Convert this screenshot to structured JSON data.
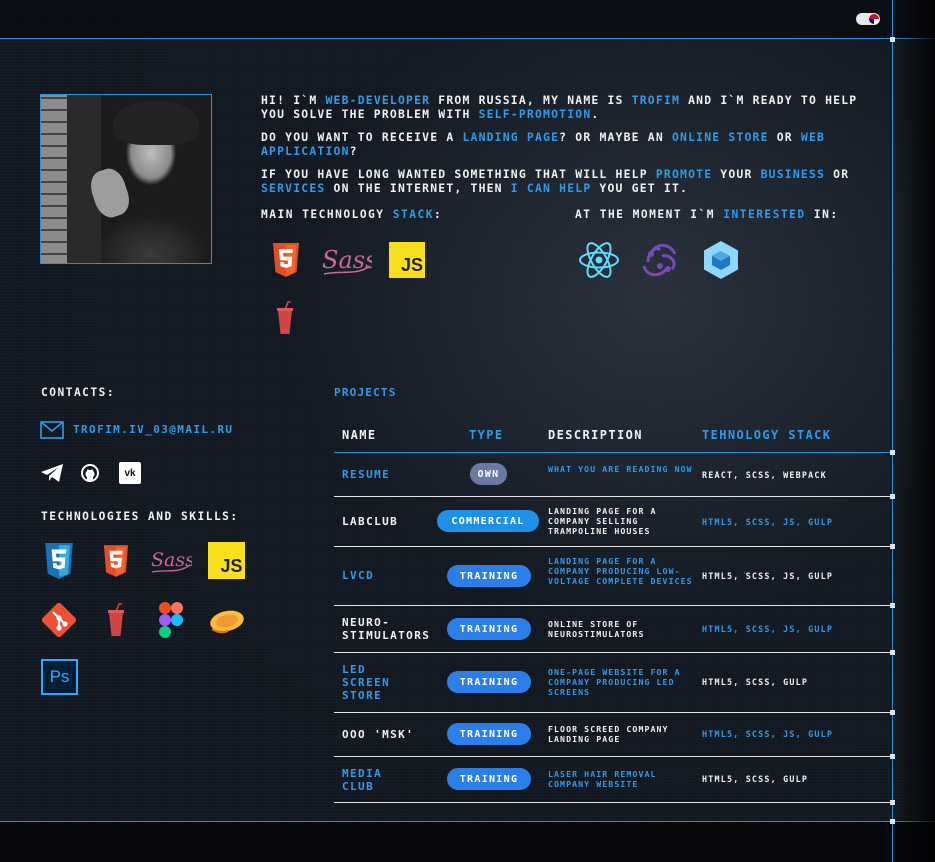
{
  "lang_toggle": {
    "flag_icon": "uk-flag-icon"
  },
  "intro": {
    "p1": [
      "Hi! I`m ",
      "web-developer",
      " from Russia, my name is ",
      "Trofim",
      " and I`m ready to help you solve the problem with ",
      "self-promotion",
      "."
    ],
    "p2": [
      "Do you want to receive a ",
      "landing page",
      "? Or maybe an ",
      "online store",
      " or ",
      "web application",
      "?"
    ],
    "p3": [
      "If you have long wanted something that will help ",
      "promote",
      " your ",
      "business",
      " or ",
      "services",
      " on the Internet, then ",
      "I can help",
      " you get it."
    ]
  },
  "stack": {
    "label_a": "Main technology ",
    "label_b": "stack",
    "label_c": ":",
    "icons": [
      "html5-icon",
      "sass-icon",
      "javascript-icon",
      "gulp-icon"
    ]
  },
  "interested": {
    "label_a": "At the moment I`m ",
    "label_b": "interested",
    "label_c": " in:",
    "icons": [
      "react-icon",
      "redux-icon",
      "webpack-icon"
    ]
  },
  "contacts": {
    "label": "Contacts:",
    "email": "trofim.iv_03@mail.ru",
    "social": [
      "telegram-icon",
      "github-icon",
      "vk-icon"
    ]
  },
  "skills": {
    "label": "Technologies and skills:",
    "icons": [
      "css3-icon",
      "html5-icon",
      "sass-icon",
      "javascript-icon",
      "git-icon",
      "gulp-icon",
      "figma-icon",
      "zeplin-icon",
      "photoshop-icon"
    ]
  },
  "projects": {
    "title": "Projects",
    "headers": {
      "name": "Name",
      "type": "Type",
      "description": "Description",
      "stack": "Tehnology stack"
    },
    "rows": [
      {
        "name": "Resume",
        "type": "own",
        "description": "What you are reading now",
        "stack": "React, SCSS, Webpack"
      },
      {
        "name": "LabClub",
        "type": "commercial",
        "description": "Landing page for a company selling trampoline houses",
        "stack": "HTML5, SCSS, JS, Gulp"
      },
      {
        "name": "LVCD",
        "type": "training",
        "description": "Landing page for a company producing low-voltage complete devices",
        "stack": "HTML5, SCSS, JS, Gulp"
      },
      {
        "name": "Neuro-stimulators",
        "type": "training",
        "description": "Online store of neurostimulators",
        "stack": "HTML5, SCSS, JS, Gulp"
      },
      {
        "name": "LED Screen Store",
        "type": "training",
        "description": "One-page website for a company producing LED screens",
        "stack": "HTML5, SCSS, Gulp"
      },
      {
        "name": "OOO 'MSK'",
        "type": "training",
        "description": "Floor screed company landing page",
        "stack": "HTML5, SCSS, JS, Gulp"
      },
      {
        "name": "Media Club",
        "type": "training",
        "description": "Laser hair removal company website",
        "stack": "HTML5, SCSS, Gulp"
      }
    ]
  },
  "colors": {
    "accent": "#2f9be9",
    "training": "#2c7fe8",
    "commercial": "#1f90e6",
    "own": "#6a7aa2"
  }
}
